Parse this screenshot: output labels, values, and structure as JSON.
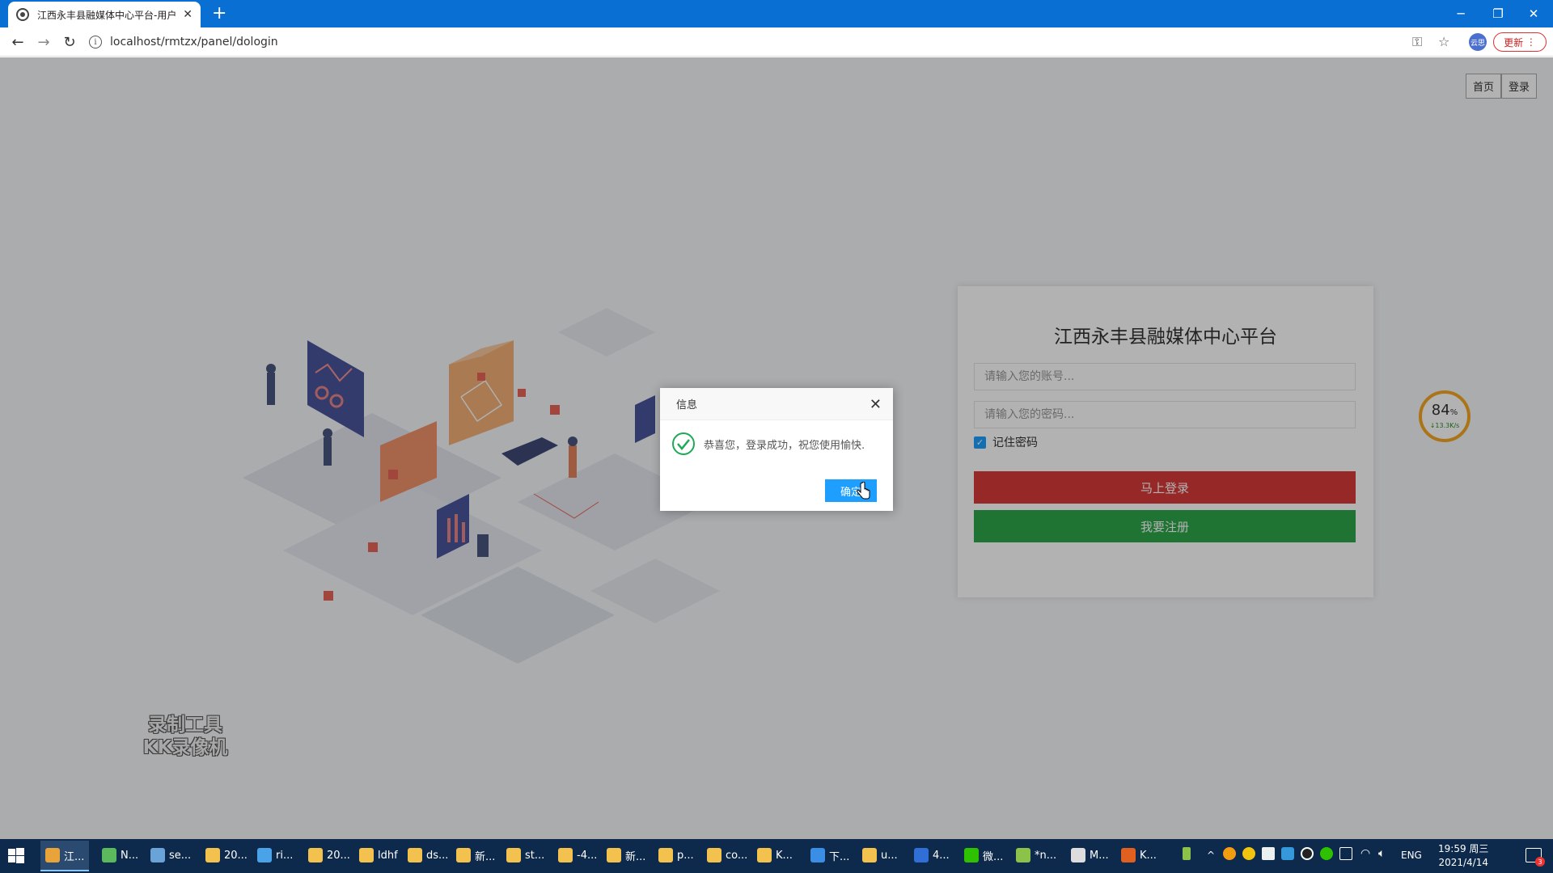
{
  "browser": {
    "tab_title": "江西永丰县融媒体中心平台-用户",
    "new_tab": "+",
    "url": "localhost/rmtzx/panel/dologin",
    "profile_label": "云思",
    "update_label": "更新"
  },
  "page": {
    "top_links": [
      "首页",
      "登录"
    ],
    "login": {
      "title": "江西永丰县融媒体中心平台",
      "account_placeholder": "请输入您的账号...",
      "password_placeholder": "请输入您的密码...",
      "remember_label": "记住密码",
      "remember_checked": true,
      "login_button": "马上登录",
      "register_button": "我要注册"
    },
    "watermark": [
      "录制工具",
      "KK录像机"
    ],
    "net_gauge": {
      "percent": "84",
      "unit": "%",
      "speed": "↓13.3K/s"
    }
  },
  "dialog": {
    "title": "信息",
    "message": "恭喜您，登录成功，祝您使用愉快.",
    "ok": "确定"
  },
  "taskbar": {
    "items": [
      {
        "label": "江...",
        "color": "#e8a33a"
      },
      {
        "label": "N...",
        "color": "#5cb85c"
      },
      {
        "label": "se...",
        "color": "#6aa3d8"
      },
      {
        "label": "20...",
        "color": "#f2c14e"
      },
      {
        "label": "ri...",
        "color": "#4aa3e8"
      },
      {
        "label": "20...",
        "color": "#f2c14e"
      },
      {
        "label": "ldhf",
        "color": "#f2c14e"
      },
      {
        "label": "ds...",
        "color": "#f2c14e"
      },
      {
        "label": "新...",
        "color": "#f2c14e"
      },
      {
        "label": "st...",
        "color": "#f2c14e"
      },
      {
        "label": "-4...",
        "color": "#f2c14e"
      },
      {
        "label": "新...",
        "color": "#f2c14e"
      },
      {
        "label": "p...",
        "color": "#f2c14e"
      },
      {
        "label": "co...",
        "color": "#f2c14e"
      },
      {
        "label": "K...",
        "color": "#f2c14e"
      },
      {
        "label": "下...",
        "color": "#3a8ee6"
      },
      {
        "label": "u...",
        "color": "#f2c14e"
      },
      {
        "label": "4...",
        "color": "#2f6fd6"
      },
      {
        "label": "微...",
        "color": "#2dc100"
      },
      {
        "label": "*n...",
        "color": "#8bc34a"
      },
      {
        "label": "M...",
        "color": "#dddddd"
      },
      {
        "label": "K...",
        "color": "#e06020"
      }
    ],
    "lang": "ENG",
    "time": "19:59 周三",
    "date": "2021/4/14",
    "notifications": "3"
  }
}
